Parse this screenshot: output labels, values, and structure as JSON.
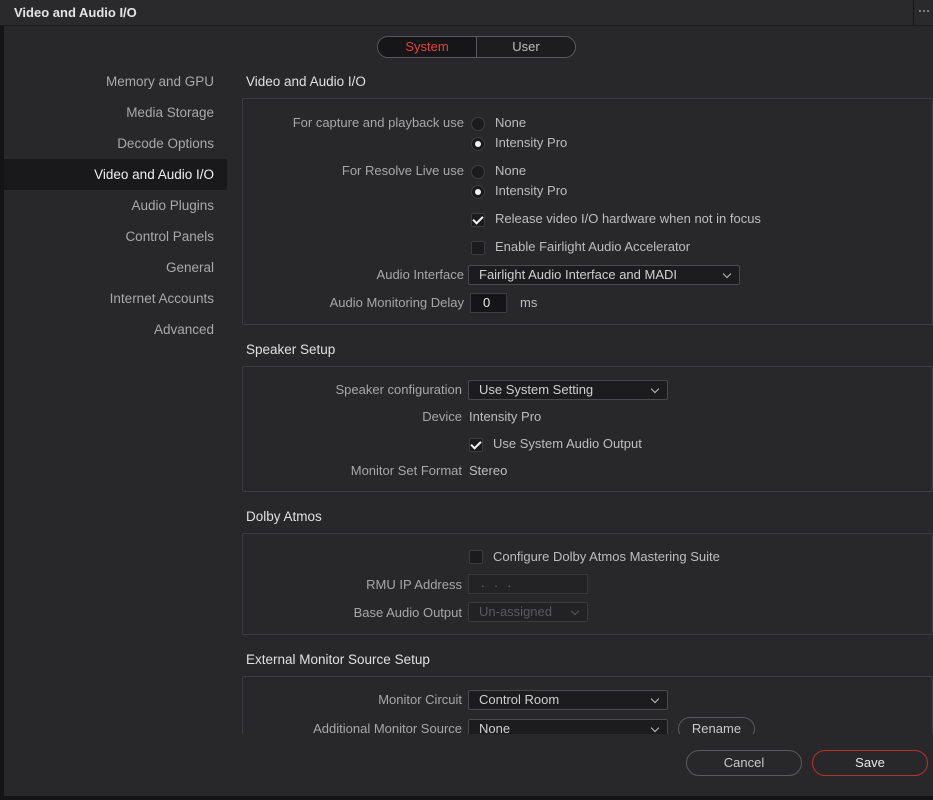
{
  "window": {
    "title": "Video and Audio I/O"
  },
  "tabs": [
    {
      "label": "System"
    },
    {
      "label": "User"
    }
  ],
  "sidebar": {
    "items": [
      {
        "label": "Memory and GPU"
      },
      {
        "label": "Media Storage"
      },
      {
        "label": "Decode Options"
      },
      {
        "label": "Video and Audio I/O"
      },
      {
        "label": "Audio Plugins"
      },
      {
        "label": "Control Panels"
      },
      {
        "label": "General"
      },
      {
        "label": "Internet Accounts"
      },
      {
        "label": "Advanced"
      }
    ],
    "active_index": 3
  },
  "video_audio_io": {
    "title": "Video and Audio I/O",
    "capture_label": "For capture and playback use",
    "capture_options": [
      "None",
      "Intensity Pro"
    ],
    "capture_selected": "Intensity Pro",
    "live_label": "For Resolve Live use",
    "live_options": [
      "None",
      "Intensity Pro"
    ],
    "live_selected": "Intensity Pro",
    "release_label": "Release video I/O hardware when not in focus",
    "release_checked": true,
    "fairlight_label": "Enable Fairlight Audio Accelerator",
    "fairlight_checked": false,
    "audio_interface_label": "Audio Interface",
    "audio_interface_value": "Fairlight Audio Interface and MADI",
    "monitoring_delay_label": "Audio Monitoring Delay",
    "monitoring_delay_value": "0",
    "monitoring_delay_unit": "ms"
  },
  "speaker_setup": {
    "title": "Speaker Setup",
    "config_label": "Speaker configuration",
    "config_value": "Use System Setting",
    "device_label": "Device",
    "device_value": "Intensity Pro",
    "use_system_audio_label": "Use System Audio Output",
    "use_system_audio_checked": true,
    "monitor_set_format_label": "Monitor Set Format",
    "monitor_set_format_value": "Stereo"
  },
  "dolby_atmos": {
    "title": "Dolby Atmos",
    "configure_label": "Configure Dolby Atmos Mastering Suite",
    "configure_checked": false,
    "rmu_ip_label": "RMU IP Address",
    "rmu_ip_value": ". . .",
    "base_output_label": "Base Audio Output",
    "base_output_value": "Un-assigned"
  },
  "external_monitor": {
    "title": "External Monitor Source Setup",
    "circuit_label": "Monitor Circuit",
    "circuit_value": "Control Room",
    "additional_label": "Additional Monitor Source",
    "additional_value": "None",
    "rename_label": "Rename"
  },
  "footer": {
    "cancel_label": "Cancel",
    "save_label": "Save"
  },
  "colors": {
    "accent": "#e2453b",
    "background": "#28282b",
    "panel_border": "#3d3d41"
  }
}
